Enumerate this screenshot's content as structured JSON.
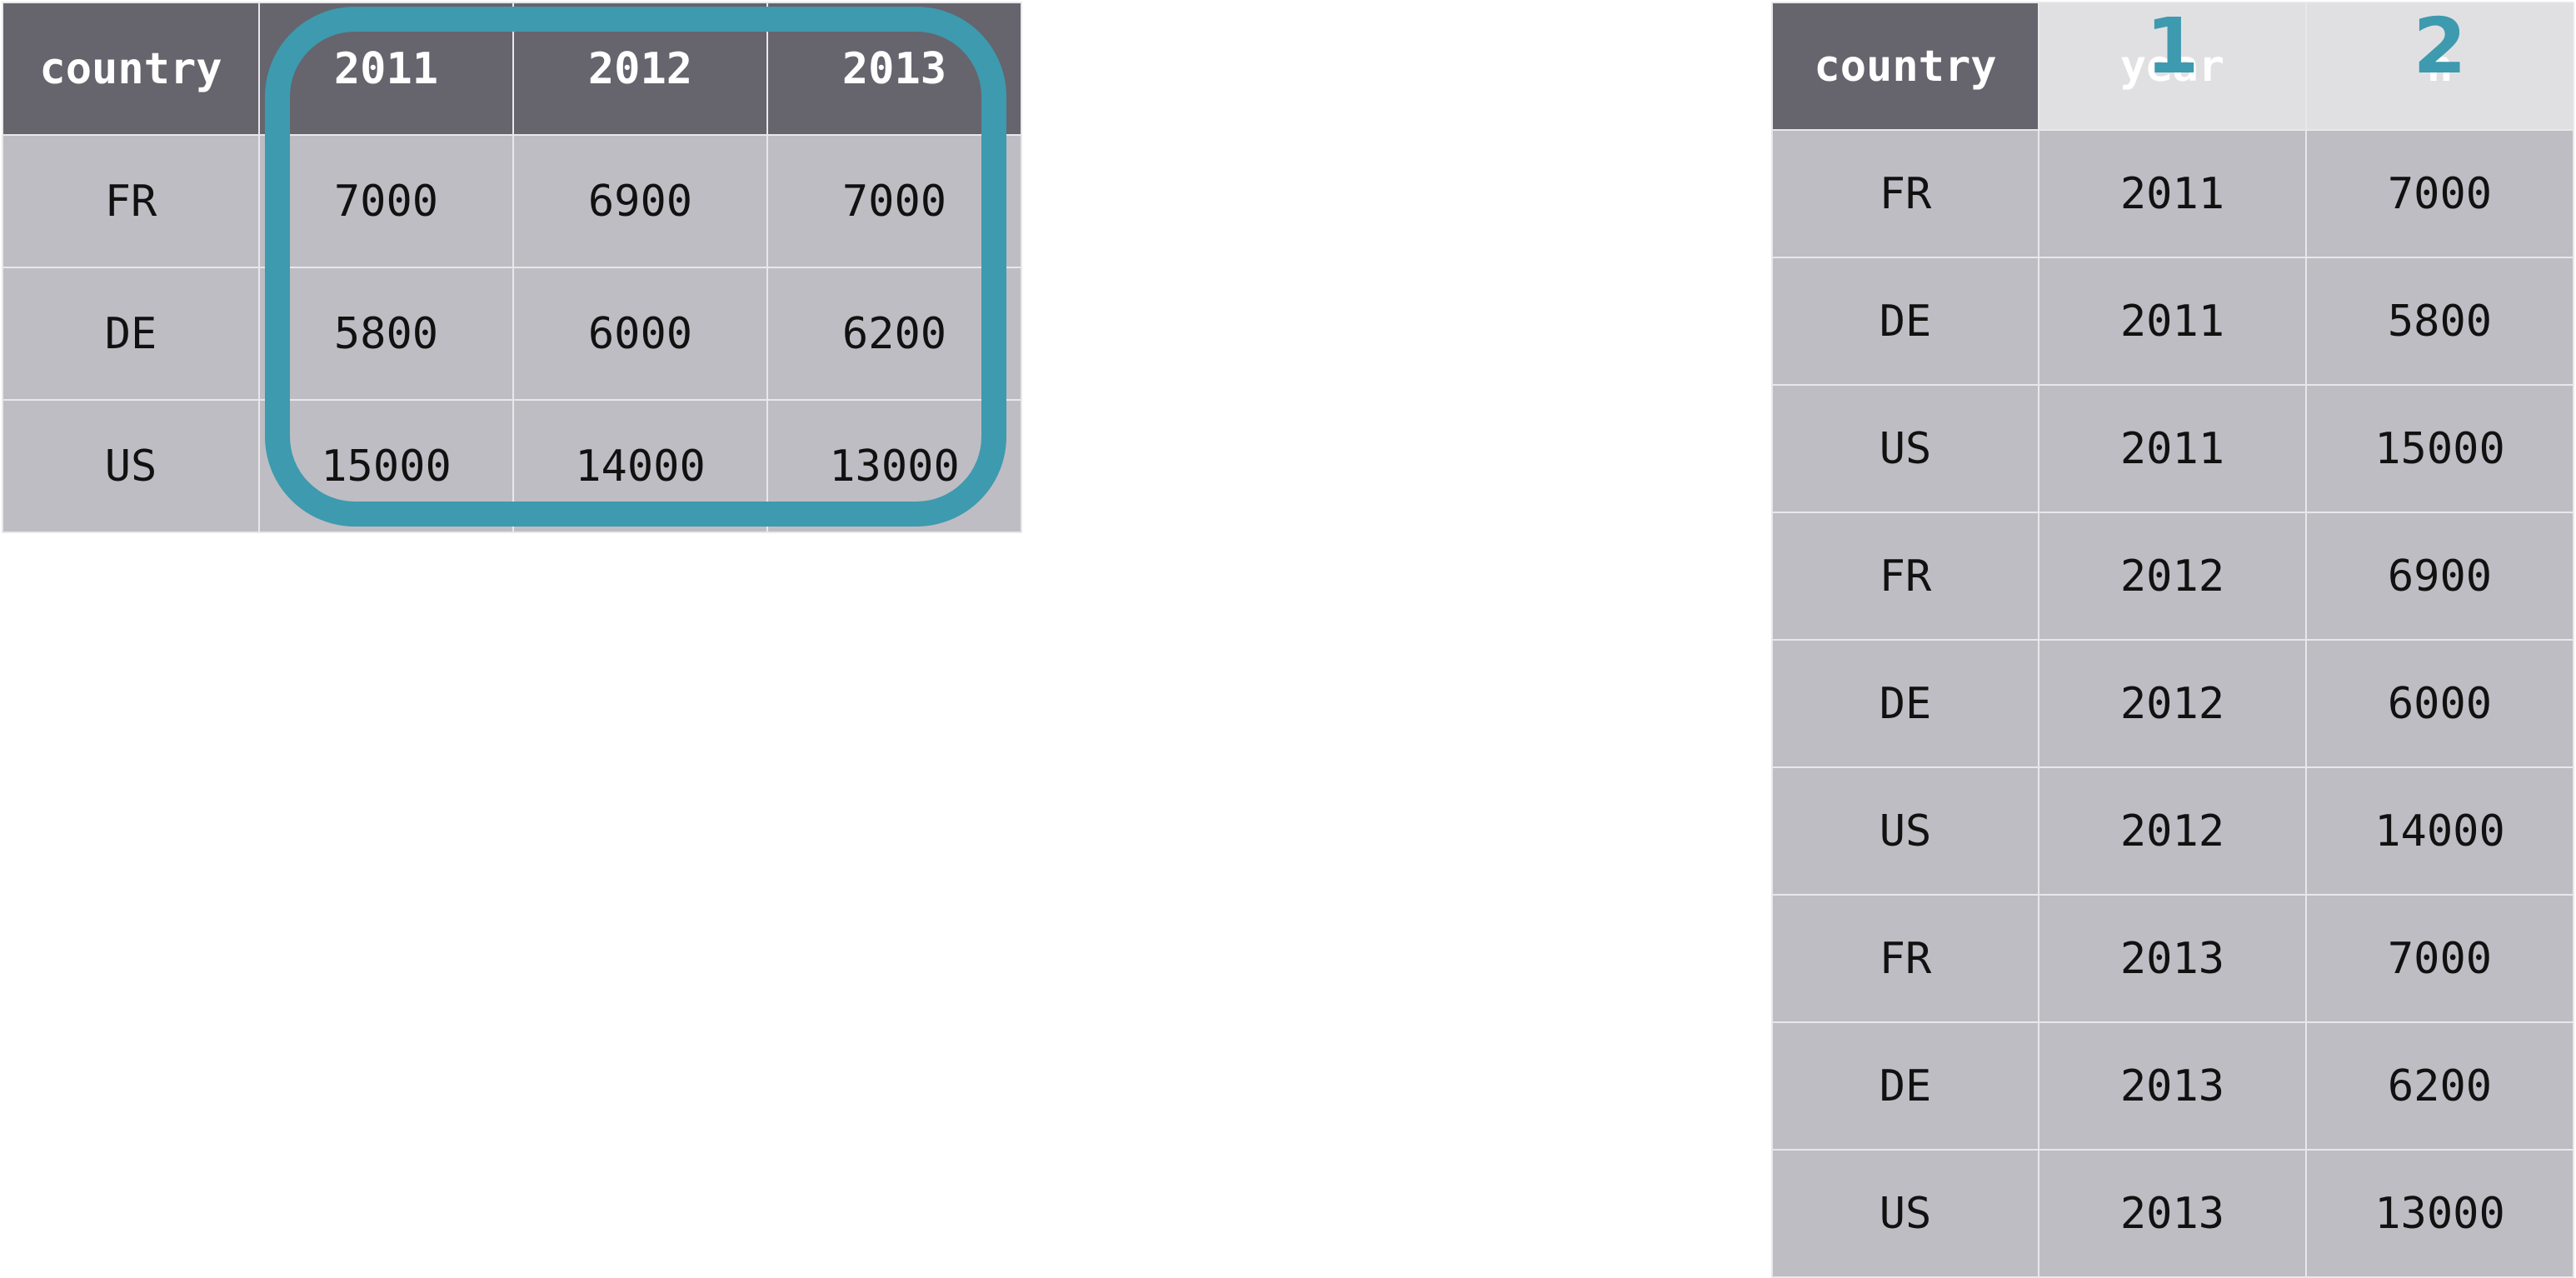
{
  "wide_table": {
    "headers": [
      "country",
      "2011",
      "2012",
      "2013"
    ],
    "rows": [
      [
        "FR",
        "7000",
        "6900",
        "7000"
      ],
      [
        "DE",
        "5800",
        "6000",
        "6200"
      ],
      [
        "US",
        "15000",
        "14000",
        "13000"
      ]
    ]
  },
  "long_table": {
    "headers": [
      "country",
      "year",
      "n"
    ],
    "header_markers": [
      "1",
      "2"
    ],
    "rows": [
      [
        "FR",
        "2011",
        "7000"
      ],
      [
        "DE",
        "2011",
        "5800"
      ],
      [
        "US",
        "2011",
        "15000"
      ],
      [
        "FR",
        "2012",
        "6900"
      ],
      [
        "DE",
        "2012",
        "6000"
      ],
      [
        "US",
        "2012",
        "14000"
      ],
      [
        "FR",
        "2013",
        "7000"
      ],
      [
        "DE",
        "2013",
        "6200"
      ],
      [
        "US",
        "2013",
        "13000"
      ]
    ]
  },
  "colors": {
    "header_bg": "#66646d",
    "cell_bg": "#bebdc3",
    "ghost_header_bg": "#e0e0e3",
    "highlight": "#3e9aae"
  }
}
